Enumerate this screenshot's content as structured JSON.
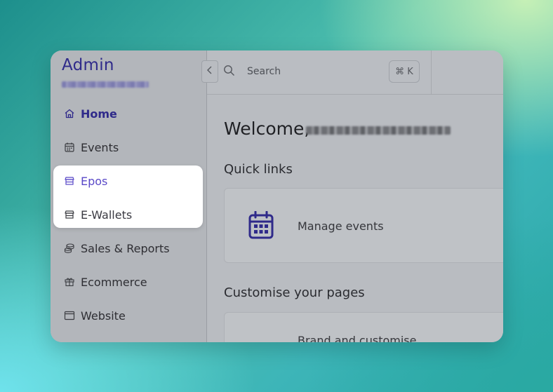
{
  "sidebar": {
    "brand_title": "Admin",
    "items": [
      {
        "label": "Home",
        "icon": "home-icon"
      },
      {
        "label": "Events",
        "icon": "calendar-icon"
      },
      {
        "label": "Epos",
        "icon": "store-icon"
      },
      {
        "label": "E-Wallets",
        "icon": "store-icon"
      },
      {
        "label": "Sales & Reports",
        "icon": "coins-icon"
      },
      {
        "label": "Ecommerce",
        "icon": "gift-icon"
      },
      {
        "label": "Website",
        "icon": "browser-icon"
      }
    ]
  },
  "topbar": {
    "search_placeholder": "Search",
    "shortcut": "⌘ K"
  },
  "main": {
    "welcome": "Welcome,",
    "quick_links_title": "Quick links",
    "quick_links": [
      {
        "label": "Manage events",
        "icon": "calendar-icon"
      }
    ],
    "customise_title": "Customise your pages",
    "customise_card_label": "Brand and customise"
  },
  "colors": {
    "accent": "#2f2a8a",
    "highlight_text": "#5a49c8"
  }
}
